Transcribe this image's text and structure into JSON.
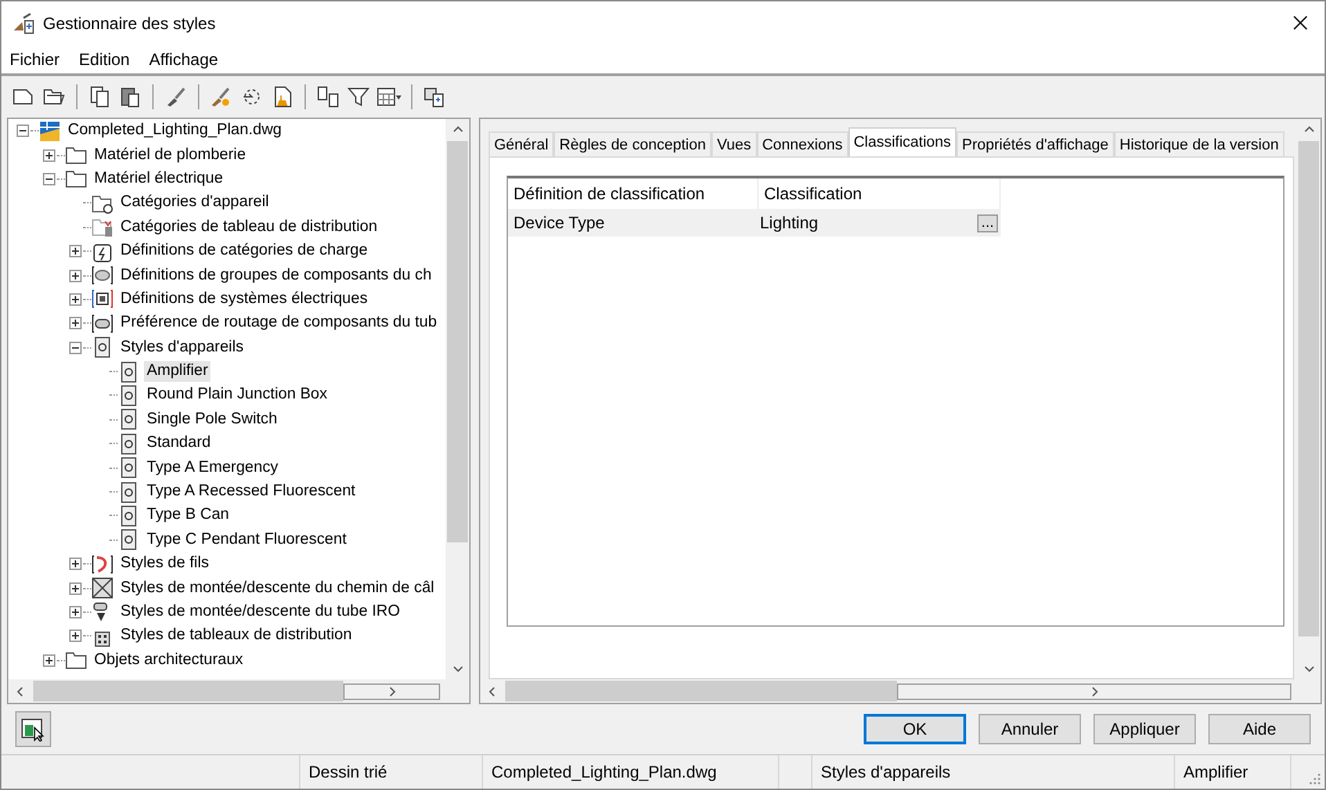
{
  "window": {
    "title": "Gestionnaire des styles"
  },
  "menu": [
    "Fichier",
    "Edition",
    "Affichage"
  ],
  "tree": [
    {
      "label": "Completed_Lighting_Plan.dwg",
      "kind": "drawing",
      "expanded": true,
      "selected": false,
      "children": [
        {
          "label": "Matériel de plomberie",
          "kind": "folder",
          "expanded": false,
          "selected": false
        },
        {
          "label": "Matériel électrique",
          "kind": "folder",
          "expanded": true,
          "selected": false,
          "children": [
            {
              "label": "Catégories d'appareil",
              "kind": "category",
              "selected": false
            },
            {
              "label": "Catégories de tableau de distribution",
              "kind": "panel-category",
              "selected": false
            },
            {
              "label": "Définitions de catégories de charge",
              "kind": "load",
              "expanded": false,
              "selected": false
            },
            {
              "label": "Définitions de groupes de composants du ch",
              "kind": "group",
              "expanded": false,
              "selected": false
            },
            {
              "label": "Définitions de systèmes électriques",
              "kind": "system",
              "expanded": false,
              "selected": false
            },
            {
              "label": "Préférence de routage de composants du tub",
              "kind": "routing",
              "expanded": false,
              "selected": false
            },
            {
              "label": "Styles d'appareils",
              "kind": "device",
              "expanded": true,
              "selected": false,
              "children": [
                {
                  "label": "Amplifier",
                  "kind": "device",
                  "selected": true
                },
                {
                  "label": "Round Plain Junction Box",
                  "kind": "device",
                  "selected": false
                },
                {
                  "label": "Single Pole Switch",
                  "kind": "device",
                  "selected": false
                },
                {
                  "label": "Standard",
                  "kind": "device",
                  "selected": false
                },
                {
                  "label": "Type A Emergency",
                  "kind": "device",
                  "selected": false
                },
                {
                  "label": "Type A Recessed Fluorescent",
                  "kind": "device",
                  "selected": false
                },
                {
                  "label": "Type B Can",
                  "kind": "device",
                  "selected": false
                },
                {
                  "label": "Type C Pendant Fluorescent",
                  "kind": "device",
                  "selected": false
                }
              ]
            },
            {
              "label": "Styles de fils",
              "kind": "wire",
              "expanded": false,
              "selected": false
            },
            {
              "label": "Styles de montée/descente du chemin de câl",
              "kind": "cable-tray",
              "expanded": false,
              "selected": false
            },
            {
              "label": "Styles de montée/descente du tube IRO",
              "kind": "conduit",
              "expanded": false,
              "selected": false
            },
            {
              "label": "Styles de tableaux de distribution",
              "kind": "panel",
              "expanded": false,
              "selected": false
            }
          ]
        },
        {
          "label": "Objets architecturaux",
          "kind": "folder",
          "expanded": false,
          "selected": false
        }
      ]
    }
  ],
  "tabs": [
    {
      "label": "Général",
      "selected": false
    },
    {
      "label": "Règles de conception",
      "selected": false
    },
    {
      "label": "Vues",
      "selected": false
    },
    {
      "label": "Connexions",
      "selected": false
    },
    {
      "label": "Classifications",
      "selected": true
    },
    {
      "label": "Propriétés d'affichage",
      "selected": false
    },
    {
      "label": "Historique de la version",
      "selected": false
    }
  ],
  "classification_table": {
    "columns": [
      "Définition de classification",
      "Classification"
    ],
    "rows": [
      {
        "definition": "Device Type",
        "classification": "Lighting",
        "button": "..."
      }
    ]
  },
  "buttons": [
    {
      "label": "OK",
      "default": true
    },
    {
      "label": "Annuler",
      "default": false
    },
    {
      "label": "Appliquer",
      "default": false
    },
    {
      "label": "Aide",
      "default": false
    }
  ],
  "status_bar": [
    "Dessin trié",
    "Completed_Lighting_Plan.dwg",
    "Styles d'appareils",
    "Amplifier"
  ]
}
